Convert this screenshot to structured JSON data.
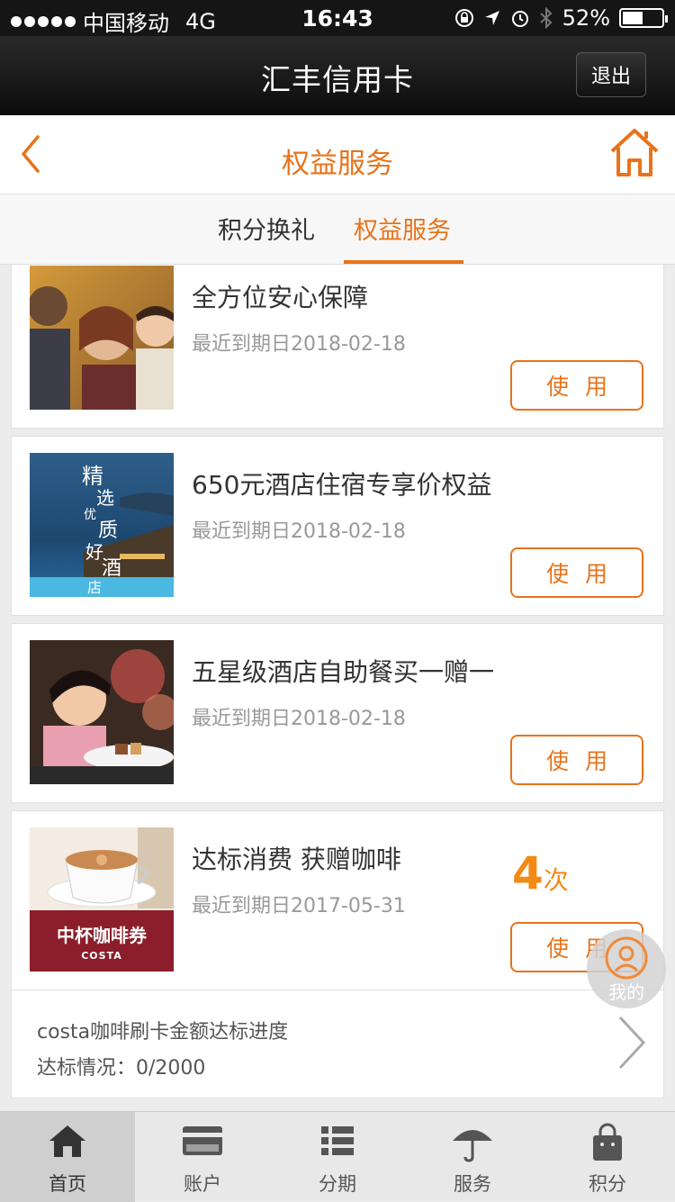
{
  "status_bar": {
    "carrier": "中国移动",
    "network": "4G",
    "time": "16:43",
    "battery": "52%",
    "battery_level": 0.52
  },
  "header": {
    "title": "汇丰信用卡",
    "logout_label": "退出"
  },
  "page": {
    "title": "权益服务"
  },
  "tabs": [
    {
      "label": "积分换礼"
    },
    {
      "label": "权益服务",
      "active": true
    }
  ],
  "items": [
    {
      "name": "全方位安心保障",
      "date": "最近到期日2018-02-18",
      "button": "使用"
    },
    {
      "name": "650元酒店住宿专享价权益",
      "date": "最近到期日2018-02-18",
      "button": "使用",
      "thumb_text": [
        "精",
        "选",
        "优",
        "质",
        "好",
        "酒",
        "店"
      ]
    },
    {
      "name": "五星级酒店自助餐买一赠一",
      "date": "最近到期日2018-02-18",
      "button": "使用"
    },
    {
      "name": "达标消费 获赠咖啡",
      "date": "最近到期日2017-05-31",
      "button": "使用",
      "count": "4",
      "count_unit": "次",
      "thumb_text": [
        "中杯咖啡券",
        "COSTA"
      ]
    }
  ],
  "progress": {
    "label": "costa咖啡刷卡金额达标进度",
    "status": "达标情况：0/2000"
  },
  "float_button": {
    "label": "我的"
  },
  "bottom_nav": [
    {
      "label": "首页",
      "icon": "home-icon",
      "active": true
    },
    {
      "label": "账户",
      "icon": "card-icon"
    },
    {
      "label": "分期",
      "icon": "list-icon"
    },
    {
      "label": "服务",
      "icon": "umbrella-icon"
    },
    {
      "label": "积分",
      "icon": "bag-icon"
    }
  ],
  "colors": {
    "accent": "#e8731a",
    "count": "#f28a14"
  }
}
